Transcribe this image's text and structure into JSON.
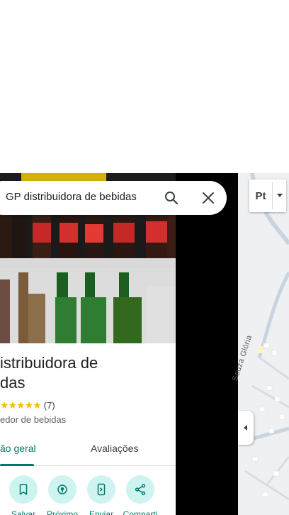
{
  "search": {
    "query": "GP distribuidora de bebidas"
  },
  "place": {
    "title_line1": "istribuidora de",
    "title_line2": "das",
    "rating": "(7)",
    "stars": "★★★★★",
    "category": "edor de bebidas"
  },
  "tabs": [
    {
      "label": "ão geral"
    },
    {
      "label": "Avaliações"
    }
  ],
  "actions": [
    {
      "label": "Salvar",
      "icon": "bookmark-icon"
    },
    {
      "label": "Próximo",
      "icon": "nearby-icon"
    },
    {
      "label": "Enviar",
      "icon": "send-to-phone-icon"
    },
    {
      "label": "Comparti",
      "icon": "share-icon"
    }
  ],
  "map": {
    "street_label": "Souza Glória",
    "layers_label": "Pt"
  },
  "colors": {
    "accent": "#00796b",
    "action_bg": "#cdf4f1",
    "star": "#fbbc04"
  }
}
